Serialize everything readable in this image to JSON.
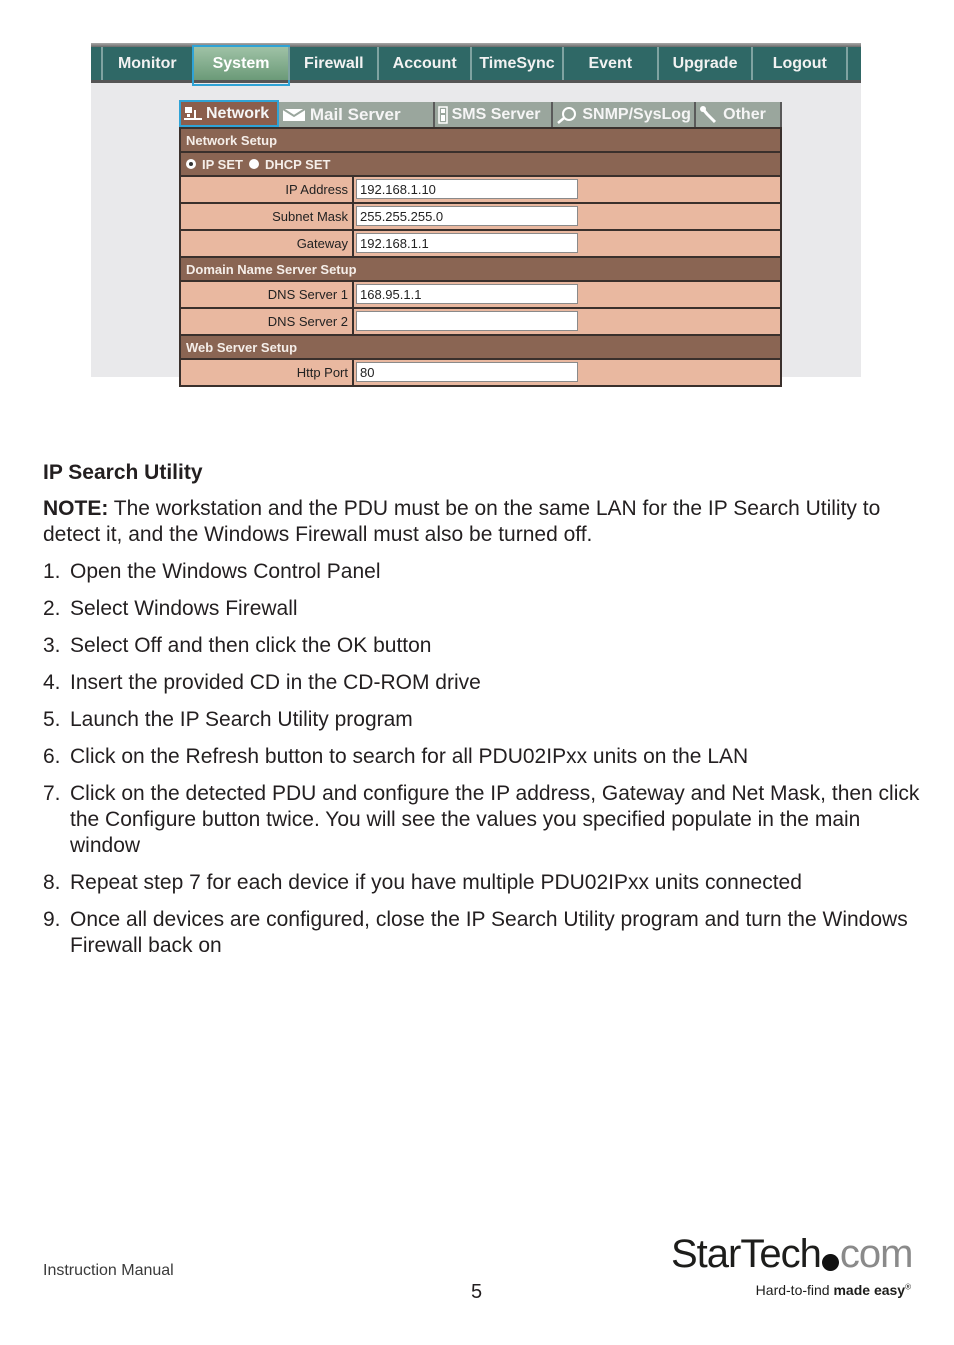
{
  "screenshot": {
    "nav": [
      "Monitor",
      "System",
      "Firewall",
      "Account",
      "TimeSync",
      "Event",
      "Upgrade",
      "Logout"
    ],
    "nav_active": "System",
    "subtabs": [
      {
        "label": "Network",
        "icon": "network-icon"
      },
      {
        "label": "Mail Server",
        "icon": "mail-icon"
      },
      {
        "label": "SMS Server",
        "icon": "phone-icon"
      },
      {
        "label": "SNMP/SysLog",
        "icon": "magnifier-icon"
      },
      {
        "label": "Other",
        "icon": "wrench-icon"
      }
    ],
    "subtab_active": "Network",
    "network_setup": {
      "title": "Network Setup",
      "radio_ip_set": "IP SET",
      "radio_dhcp_set": "DHCP SET",
      "ip_set_selected": true,
      "fields": [
        {
          "label": "IP Address",
          "value": "192.168.1.10"
        },
        {
          "label": "Subnet Mask",
          "value": "255.255.255.0"
        },
        {
          "label": "Gateway",
          "value": "192.168.1.1"
        }
      ]
    },
    "dns_setup": {
      "title": "Domain Name Server Setup",
      "fields": [
        {
          "label": "DNS Server 1",
          "value": "168.95.1.1"
        },
        {
          "label": "DNS Server 2",
          "value": ""
        }
      ]
    },
    "web_setup": {
      "title": "Web Server Setup",
      "fields": [
        {
          "label": "Http Port",
          "value": "80"
        }
      ]
    }
  },
  "doc": {
    "heading": "IP Search Utility",
    "note_label": "NOTE:",
    "note_text": " The workstation and the PDU must be on the same LAN for the IP Search Utility to detect it, and the Windows Firewall must also be turned off.",
    "steps": [
      {
        "num": "1.",
        "text": "Open the Windows Control Panel"
      },
      {
        "num": "2.",
        "text": "Select Windows Firewall"
      },
      {
        "num": "3.",
        "text": "Select Off and then click the OK button"
      },
      {
        "num": "4.",
        "text": "Insert the provided CD in the CD-ROM drive"
      },
      {
        "num": "5.",
        "text": "Launch the IP Search Utility program"
      },
      {
        "num": "6.",
        "text": "Click on the Refresh button to search for all PDU02IPxx units on the LAN"
      },
      {
        "num": "7.",
        "text": "Click on the detected PDU and configure the IP address, Gateway and Net Mask, then click the Configure button twice. You will see the values you specified populate in the main window"
      },
      {
        "num": "8.",
        "text": "Repeat step 7 for each device if you have multiple PDU02IPxx units connected"
      },
      {
        "num": "9.",
        "text": "Once all devices are configured, close the IP Search Utility program and turn the Windows Firewall back on"
      }
    ]
  },
  "footer": {
    "left": "Instruction Manual",
    "page": "5",
    "logo_star": "StarTech",
    "logo_com": "com",
    "tagline_light": "Hard-to-find ",
    "tagline_bold": "made easy",
    "tagline_mark": "®"
  },
  "colors": {
    "nav_bg": "#2f6866",
    "nav_active": "#8fb898",
    "section_bg": "#8a6553",
    "row_bg": "#e9b8a0",
    "focus": "#2fa3d6"
  }
}
